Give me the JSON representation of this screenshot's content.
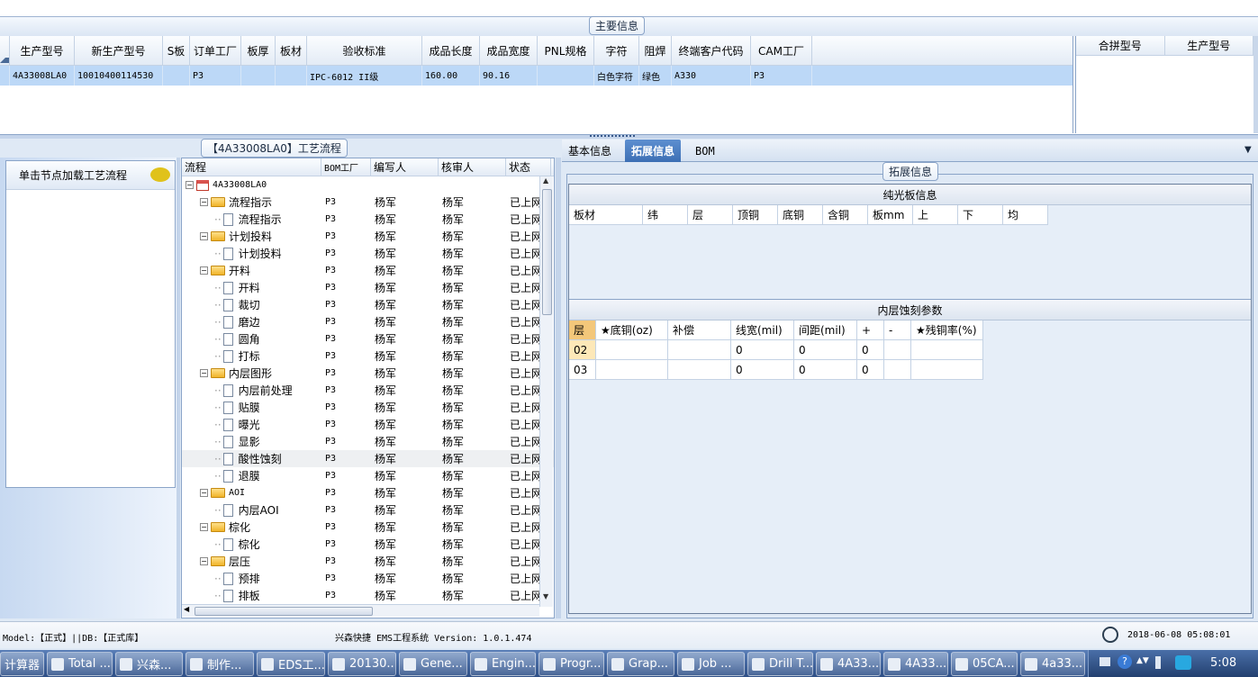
{
  "main_info": {
    "title": "主要信息",
    "columns": [
      "生产型号",
      "新生产型号",
      "S板",
      "订单工厂",
      "板厚",
      "板材",
      "验收标准",
      "成品长度",
      "成品宽度",
      "PNL规格",
      "字符",
      "阻焊",
      "终端客户代码",
      "CAM工厂"
    ],
    "row": [
      "4A33008LA0",
      "10010400114530",
      "",
      "P3",
      "",
      "",
      "IPC-6012 II级",
      "160.00",
      "90.16",
      "",
      "白色字符",
      "绿色",
      "A330",
      "P3"
    ],
    "side_columns": [
      "合拼型号",
      "生产型号"
    ]
  },
  "left_panel": {
    "load_label": "单击节点加载工艺流程",
    "chat_icon": "speech-bubble-icon"
  },
  "process": {
    "title": "【4A33008LA0】工艺流程",
    "columns": [
      "流程",
      "BOM工厂",
      "编写人",
      "核审人",
      "状态"
    ],
    "root": "4A33008LA0",
    "rows": [
      {
        "level": 1,
        "type": "folder",
        "name": "流程指示",
        "bom": "P3",
        "writer": "杨军",
        "reviewer": "杨军",
        "status": "已上网"
      },
      {
        "level": 2,
        "type": "doc",
        "name": "流程指示",
        "bom": "P3",
        "writer": "杨军",
        "reviewer": "杨军",
        "status": "已上网"
      },
      {
        "level": 1,
        "type": "folder",
        "name": "计划投料",
        "bom": "P3",
        "writer": "杨军",
        "reviewer": "杨军",
        "status": "已上网"
      },
      {
        "level": 2,
        "type": "doc",
        "name": "计划投料",
        "bom": "P3",
        "writer": "杨军",
        "reviewer": "杨军",
        "status": "已上网"
      },
      {
        "level": 1,
        "type": "folder",
        "name": "开料",
        "bom": "P3",
        "writer": "杨军",
        "reviewer": "杨军",
        "status": "已上网"
      },
      {
        "level": 2,
        "type": "doc",
        "name": "开料",
        "bom": "P3",
        "writer": "杨军",
        "reviewer": "杨军",
        "status": "已上网"
      },
      {
        "level": 2,
        "type": "doc",
        "name": "裁切",
        "bom": "P3",
        "writer": "杨军",
        "reviewer": "杨军",
        "status": "已上网"
      },
      {
        "level": 2,
        "type": "doc",
        "name": "磨边",
        "bom": "P3",
        "writer": "杨军",
        "reviewer": "杨军",
        "status": "已上网"
      },
      {
        "level": 2,
        "type": "doc",
        "name": "圆角",
        "bom": "P3",
        "writer": "杨军",
        "reviewer": "杨军",
        "status": "已上网"
      },
      {
        "level": 2,
        "type": "doc",
        "name": "打标",
        "bom": "P3",
        "writer": "杨军",
        "reviewer": "杨军",
        "status": "已上网"
      },
      {
        "level": 1,
        "type": "folder",
        "name": "内层图形",
        "bom": "P3",
        "writer": "杨军",
        "reviewer": "杨军",
        "status": "已上网"
      },
      {
        "level": 2,
        "type": "doc",
        "name": "内层前处理",
        "bom": "P3",
        "writer": "杨军",
        "reviewer": "杨军",
        "status": "已上网"
      },
      {
        "level": 2,
        "type": "doc",
        "name": "贴膜",
        "bom": "P3",
        "writer": "杨军",
        "reviewer": "杨军",
        "status": "已上网"
      },
      {
        "level": 2,
        "type": "doc",
        "name": "曝光",
        "bom": "P3",
        "writer": "杨军",
        "reviewer": "杨军",
        "status": "已上网"
      },
      {
        "level": 2,
        "type": "doc",
        "name": "显影",
        "bom": "P3",
        "writer": "杨军",
        "reviewer": "杨军",
        "status": "已上网"
      },
      {
        "level": 2,
        "type": "doc",
        "name": "酸性蚀刻",
        "bom": "P3",
        "writer": "杨军",
        "reviewer": "杨军",
        "status": "已上网",
        "selected": true
      },
      {
        "level": 2,
        "type": "doc",
        "name": "退膜",
        "bom": "P3",
        "writer": "杨军",
        "reviewer": "杨军",
        "status": "已上网"
      },
      {
        "level": 1,
        "type": "folder",
        "name": "AOI",
        "bom": "P3",
        "writer": "杨军",
        "reviewer": "杨军",
        "status": "已上网"
      },
      {
        "level": 2,
        "type": "doc",
        "name": "内层AOI",
        "bom": "P3",
        "writer": "杨军",
        "reviewer": "杨军",
        "status": "已上网"
      },
      {
        "level": 1,
        "type": "folder",
        "name": "棕化",
        "bom": "P3",
        "writer": "杨军",
        "reviewer": "杨军",
        "status": "已上网"
      },
      {
        "level": 2,
        "type": "doc",
        "name": "棕化",
        "bom": "P3",
        "writer": "杨军",
        "reviewer": "杨军",
        "status": "已上网"
      },
      {
        "level": 1,
        "type": "folder",
        "name": "层压",
        "bom": "P3",
        "writer": "杨军",
        "reviewer": "杨军",
        "status": "已上网"
      },
      {
        "level": 2,
        "type": "doc",
        "name": "预排",
        "bom": "P3",
        "writer": "杨军",
        "reviewer": "杨军",
        "status": "已上网"
      },
      {
        "level": 2,
        "type": "doc",
        "name": "排板",
        "bom": "P3",
        "writer": "杨军",
        "reviewer": "杨军",
        "status": "已上网"
      }
    ]
  },
  "right": {
    "tabs": [
      "基本信息",
      "拓展信息",
      "BOM"
    ],
    "active_tab": "拓展信息",
    "group_title": "拓展信息",
    "plain_board": {
      "title": "纯光板信息",
      "columns": [
        "板材",
        "纬",
        "层",
        "顶铜",
        "底铜",
        "含铜",
        "板mm",
        "上",
        "下",
        "均"
      ]
    },
    "inner_etch": {
      "title": "内层蚀刻参数",
      "columns": [
        "层",
        "★底铜(oz)",
        "补偿",
        "线宽(mil)",
        "间距(mil)",
        "+",
        "-",
        "★残铜率(%)"
      ],
      "rows": [
        [
          "02",
          "",
          "",
          "0",
          "0",
          "0",
          "",
          ""
        ],
        [
          "03",
          "",
          "",
          "0",
          "0",
          "0",
          "",
          ""
        ]
      ]
    }
  },
  "status_bar": {
    "model": "Model:【正式】||DB:【正式库】",
    "system": "兴森快捷 EMS工程系统 Version: 1.0.1.474",
    "datetime": "2018-06-08 05:08:01"
  },
  "taskbar": {
    "items": [
      "计算器",
      "Total ...",
      "兴森...",
      "制作...",
      "EDS工...",
      "20130...",
      "Gene...",
      "Engin...",
      "Progr...",
      "Grap...",
      "Job ...",
      "Drill T...",
      "4A33...",
      "4A33...",
      "05CA...",
      "4a33..."
    ],
    "clock": "5:08"
  }
}
